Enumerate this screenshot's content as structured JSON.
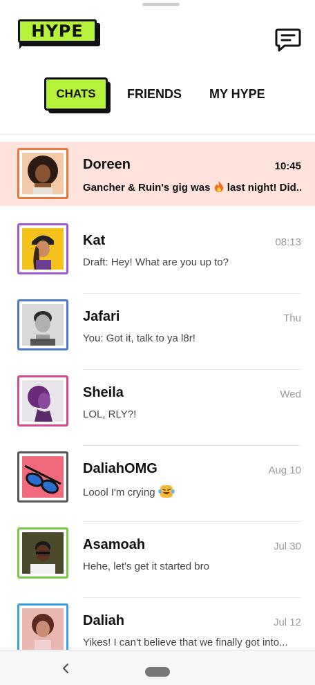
{
  "app": {
    "logo_text": "HYPE"
  },
  "tabs": {
    "chats": "CHATS",
    "friends": "FRIENDS",
    "my_hype": "MY HYPE"
  },
  "colors": {
    "accent": "#b6f23a",
    "active_row": "#fde3db"
  },
  "chats": [
    {
      "name": "Doreen",
      "time": "10:45",
      "preview": "Gancher & Ruin's gig was",
      "preview_emoji": "fire-emoji",
      "preview_after": " last night! Did...",
      "frame": "#e8773a"
    },
    {
      "name": "Kat",
      "time": "08:13",
      "preview": "Draft: Hey! What are you up to?",
      "frame": "#9b59d6"
    },
    {
      "name": "Jafari",
      "time": "Thu",
      "preview": "You: Got it, talk to ya l8r!",
      "frame": "#4a77d6"
    },
    {
      "name": "Sheila",
      "time": "Wed",
      "preview": "LOL, RLY?!",
      "frame": "#d64a8f"
    },
    {
      "name": "DaliahOMG",
      "time": "Aug 10",
      "preview": "Loool I'm crying",
      "preview_emoji": "laughing-crying-emoji",
      "frame": "#555555"
    },
    {
      "name": "Asamoah",
      "time": "Jul 30",
      "preview": "Hehe, let's get it started bro",
      "frame": "#7ac943"
    },
    {
      "name": "Daliah",
      "time": "Jul 12",
      "preview": "Yikes! I can't believe that we finally got into...",
      "frame": "#3aa0e8"
    }
  ]
}
